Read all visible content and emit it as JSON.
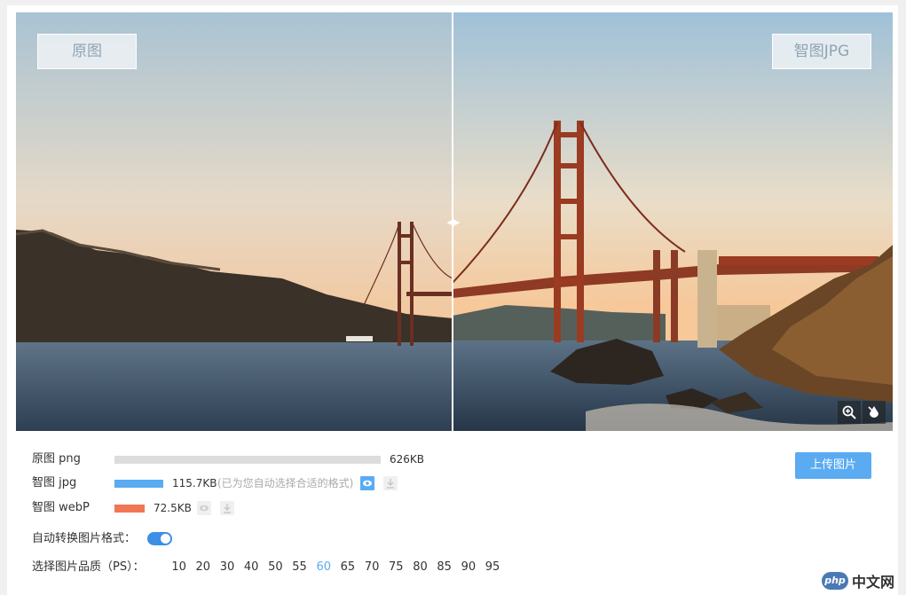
{
  "compare": {
    "left_tag": "原图",
    "right_tag": "智图JPG"
  },
  "stats": [
    {
      "label": "原图 png",
      "size": "626KB",
      "bar_fraction": 1.0,
      "bar_color": "#dcdcdc",
      "note": ""
    },
    {
      "label": "智图 jpg",
      "size": "115.7KB",
      "bar_fraction": 0.185,
      "bar_color": "#5aabf2",
      "note": "(已为您自动选择合适的格式)"
    },
    {
      "label": "智图 webP",
      "size": "72.5KB",
      "bar_fraction": 0.116,
      "bar_color": "#f07655",
      "note": ""
    }
  ],
  "upload_button": "上传图片",
  "auto_convert": {
    "label": "自动转换图片格式：",
    "enabled": true
  },
  "quality": {
    "label": "选择图片品质（PS）：",
    "options": [
      "10",
      "20",
      "30",
      "40",
      "50",
      "55",
      "60",
      "65",
      "70",
      "75",
      "80",
      "85",
      "90",
      "95"
    ],
    "selected": "60"
  },
  "watermark": {
    "logo": "php",
    "text": "中文网"
  },
  "colors": {
    "accent": "#5aabf2",
    "jpg_bar": "#5aabf2",
    "webp_bar": "#f07655",
    "png_bar": "#dcdcdc"
  },
  "icons": [
    "zoom-in-icon",
    "color-drop-icon",
    "eye-icon",
    "download-icon",
    "divider-arrows-icon"
  ]
}
